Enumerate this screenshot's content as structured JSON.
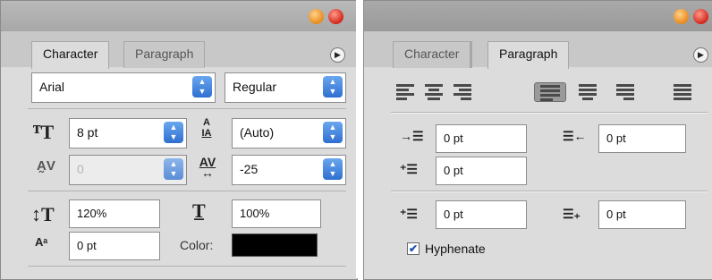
{
  "character_panel": {
    "tabs": [
      "Character",
      "Paragraph"
    ],
    "font_family": "Arial",
    "font_style": "Regular",
    "font_size": "8 pt",
    "leading": "(Auto)",
    "kerning": "0",
    "tracking": "-25",
    "vertical_scale": "120%",
    "horizontal_scale": "100%",
    "baseline_shift": "0 pt",
    "color_label": "Color:",
    "color_value": "#000000"
  },
  "paragraph_panel": {
    "tabs": [
      "Character",
      "Paragraph"
    ],
    "indent_left": "0 pt",
    "indent_right": "0 pt",
    "indent_first_line": "0 pt",
    "space_before": "0 pt",
    "space_after": "0 pt",
    "hyphenate_label": "Hyphenate",
    "hyphenate_checked": true
  }
}
